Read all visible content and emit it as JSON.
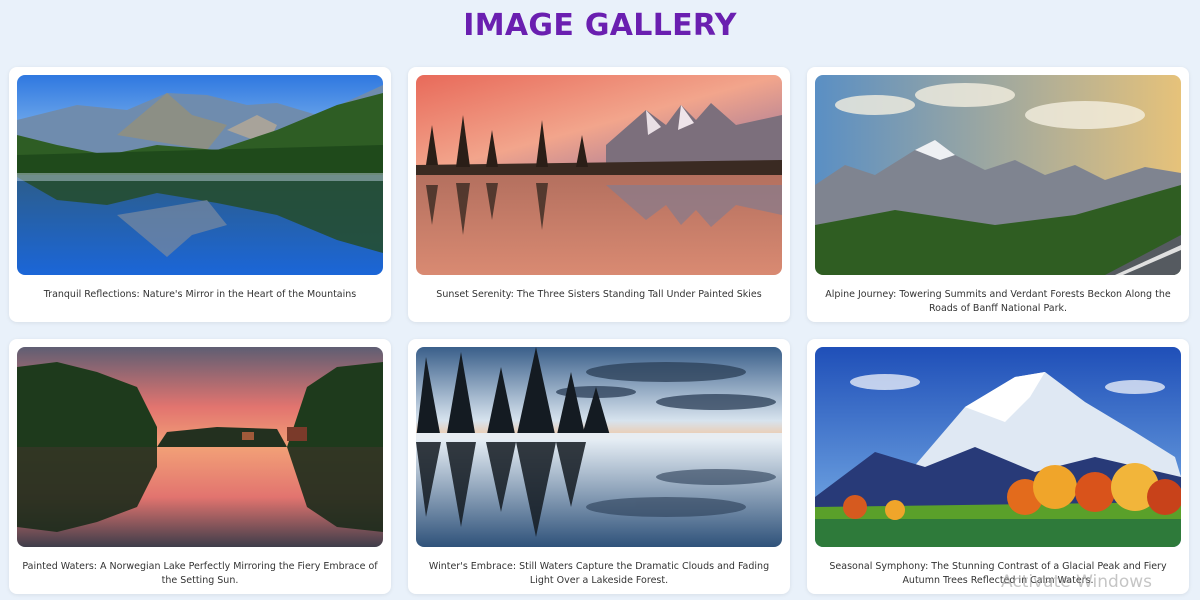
{
  "header": {
    "title": "IMAGE GALLERY"
  },
  "gallery": {
    "items": [
      {
        "caption": "Tranquil Reflections: Nature's Mirror in the Heart of the Mountains"
      },
      {
        "caption": "Sunset Serenity: The Three Sisters Standing Tall Under Painted Skies"
      },
      {
        "caption": "Alpine Journey: Towering Summits and Verdant Forests Beckon Along the Roads of Banff National Park."
      },
      {
        "caption": "Painted Waters: A Norwegian Lake Perfectly Mirroring the Fiery Embrace of the Setting Sun."
      },
      {
        "caption": "Winter's Embrace: Still Waters Capture the Dramatic Clouds and Fading Light Over a Lakeside Forest."
      },
      {
        "caption": "Seasonal Symphony: The Stunning Contrast of a Glacial Peak and Fiery Autumn Trees Reflected in Calm Waters."
      }
    ]
  },
  "overlay": {
    "watermark": "Activate Windows"
  },
  "colors": {
    "title": "#6a1fb0",
    "background": "#e9f1fa",
    "card": "#ffffff"
  }
}
